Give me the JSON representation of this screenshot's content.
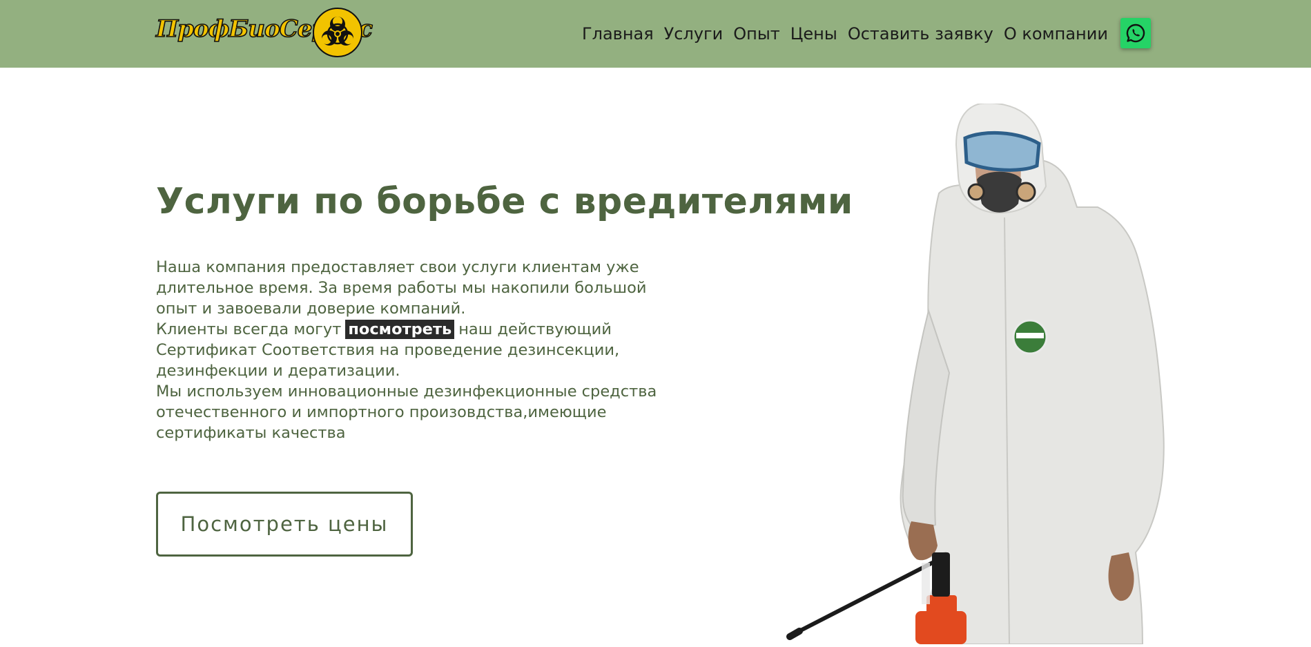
{
  "header": {
    "logo_text": "ПрофБиоСервис",
    "nav": [
      "Главная",
      "Услуги",
      "Опыт",
      "Цены",
      "Оставить заявку",
      "О компании"
    ],
    "whatsapp_icon": "whatsapp-icon"
  },
  "hero": {
    "title": "Услуги по борьбе с вредителями",
    "para1": "Наша компания предоставляет свои услуги клиентам уже длительное время. За время работы мы накопили большой опыт и завоевали доверие компаний.",
    "para2_before": "Клиенты всегда могут",
    "para2_link": "посмотреть",
    "para2_after": "наш действующий Сертификат Соответствия на проведение дезинсекции, дезинфекции и дератизации.",
    "para3": "Мы используем инновационные дезинфекционные средства отечественного и импортного произовдства,имеющие сертификаты качества",
    "cta_label": "Посмотреть цены"
  },
  "colors": {
    "header_bg": "#93b080",
    "text": "#4e6440",
    "whatsapp": "#25d366",
    "logo_yellow": "#f2c300"
  }
}
